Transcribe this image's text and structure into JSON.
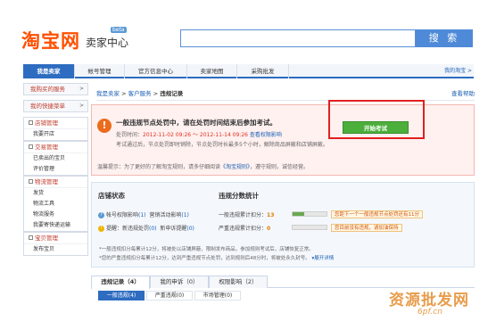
{
  "header": {
    "logo": "淘宝网",
    "subtitle": "卖家中心",
    "beta": "beta",
    "search_placeholder": "",
    "search_button": "搜 索"
  },
  "nav": {
    "tabs": [
      "我是卖家",
      "帐号管理",
      "官方信息中心",
      "卖家地图",
      "采购批发"
    ],
    "right_link": "我的淘宝 >"
  },
  "sidebar": {
    "quick1": "我购买的服务",
    "quick2": "我的快捷菜单",
    "groups": [
      {
        "title": "店铺管理",
        "items": [
          "我要开店"
        ]
      },
      {
        "title": "交易管理",
        "items": [
          "已卖出的宝贝",
          "评价管理"
        ]
      },
      {
        "title": "物流管理",
        "items": [
          "发货",
          "物流工具",
          "物流服务",
          "我要寄快递运输"
        ]
      },
      {
        "title": "宝贝管理",
        "items": [
          "发布宝贝"
        ]
      }
    ]
  },
  "crumbs": {
    "home": "我是卖家",
    "sep": ">",
    "section": "客户服务",
    "current": "违规记录",
    "help": "查看帮助"
  },
  "alert": {
    "title": "一般违规节点处罚中，请在处罚时间结束后参加考试。",
    "period_label": "处罚时间：",
    "period_value": "2012-11-02 09:26 ～ 2012-11-14 09:26",
    "period_link": "查看权限影响",
    "line2": "考试通过后，节点处罚即时销除，节点处罚时长最多5个小时，解除商品屏蔽和店铺屏蔽。",
    "footer_text": "温馨提示：为了更好的了解淘宝规则，请多仔细阅读",
    "footer_link": "《淘宝规则》",
    "footer_tail": "，遵守规则，诚信经营。",
    "exam_button": "开始考试"
  },
  "status": {
    "title": "店铺状态",
    "row1_a": "帐号权限影响",
    "row1_a_count": "(1)",
    "row1_b": "营销活动影响",
    "row1_b_count": "(1)",
    "row2_a": "提醒：新违规处罚",
    "row2_a_count": "(0)",
    "row2_b": "新申诉提醒",
    "row2_b_count": "(0)"
  },
  "stats": {
    "title": "违规分数统计",
    "general_label": "一般违规累计扣分：",
    "general_value": "13",
    "general_fill": 0.35,
    "general_tip": "您距下一个一般违规节点处罚还有11分",
    "serious_label": "严重违规累计扣分：",
    "serious_value": "0",
    "serious_fill": 0.0,
    "serious_tip": "您目前没有违规，请加油保持"
  },
  "notes": {
    "line1": "*一般违规扣分每累计12分，将被处以店铺屏蔽，限制发布商品，参加规则考试后，店铺恢复正常。",
    "line2": "*您的严重违规扣分每累计12分，达到严重违规节点处罚，达到规则后48分时，将被处永久封号。",
    "link": "展开详情"
  },
  "tabs": {
    "items": [
      "违规记录（4）",
      "我的申诉（0）",
      "权限影响（2）"
    ]
  },
  "subtabs": {
    "items": [
      "一般违规(4)",
      "严重违规(0)",
      "市场管理(0)"
    ]
  },
  "watermark": {
    "text": "资源批发网",
    "sub": "6pf.cn"
  },
  "colors": {
    "brand": "#ff5000",
    "primary": "#2d6cc0",
    "alert": "#e0301e",
    "success": "#4caf3c"
  }
}
